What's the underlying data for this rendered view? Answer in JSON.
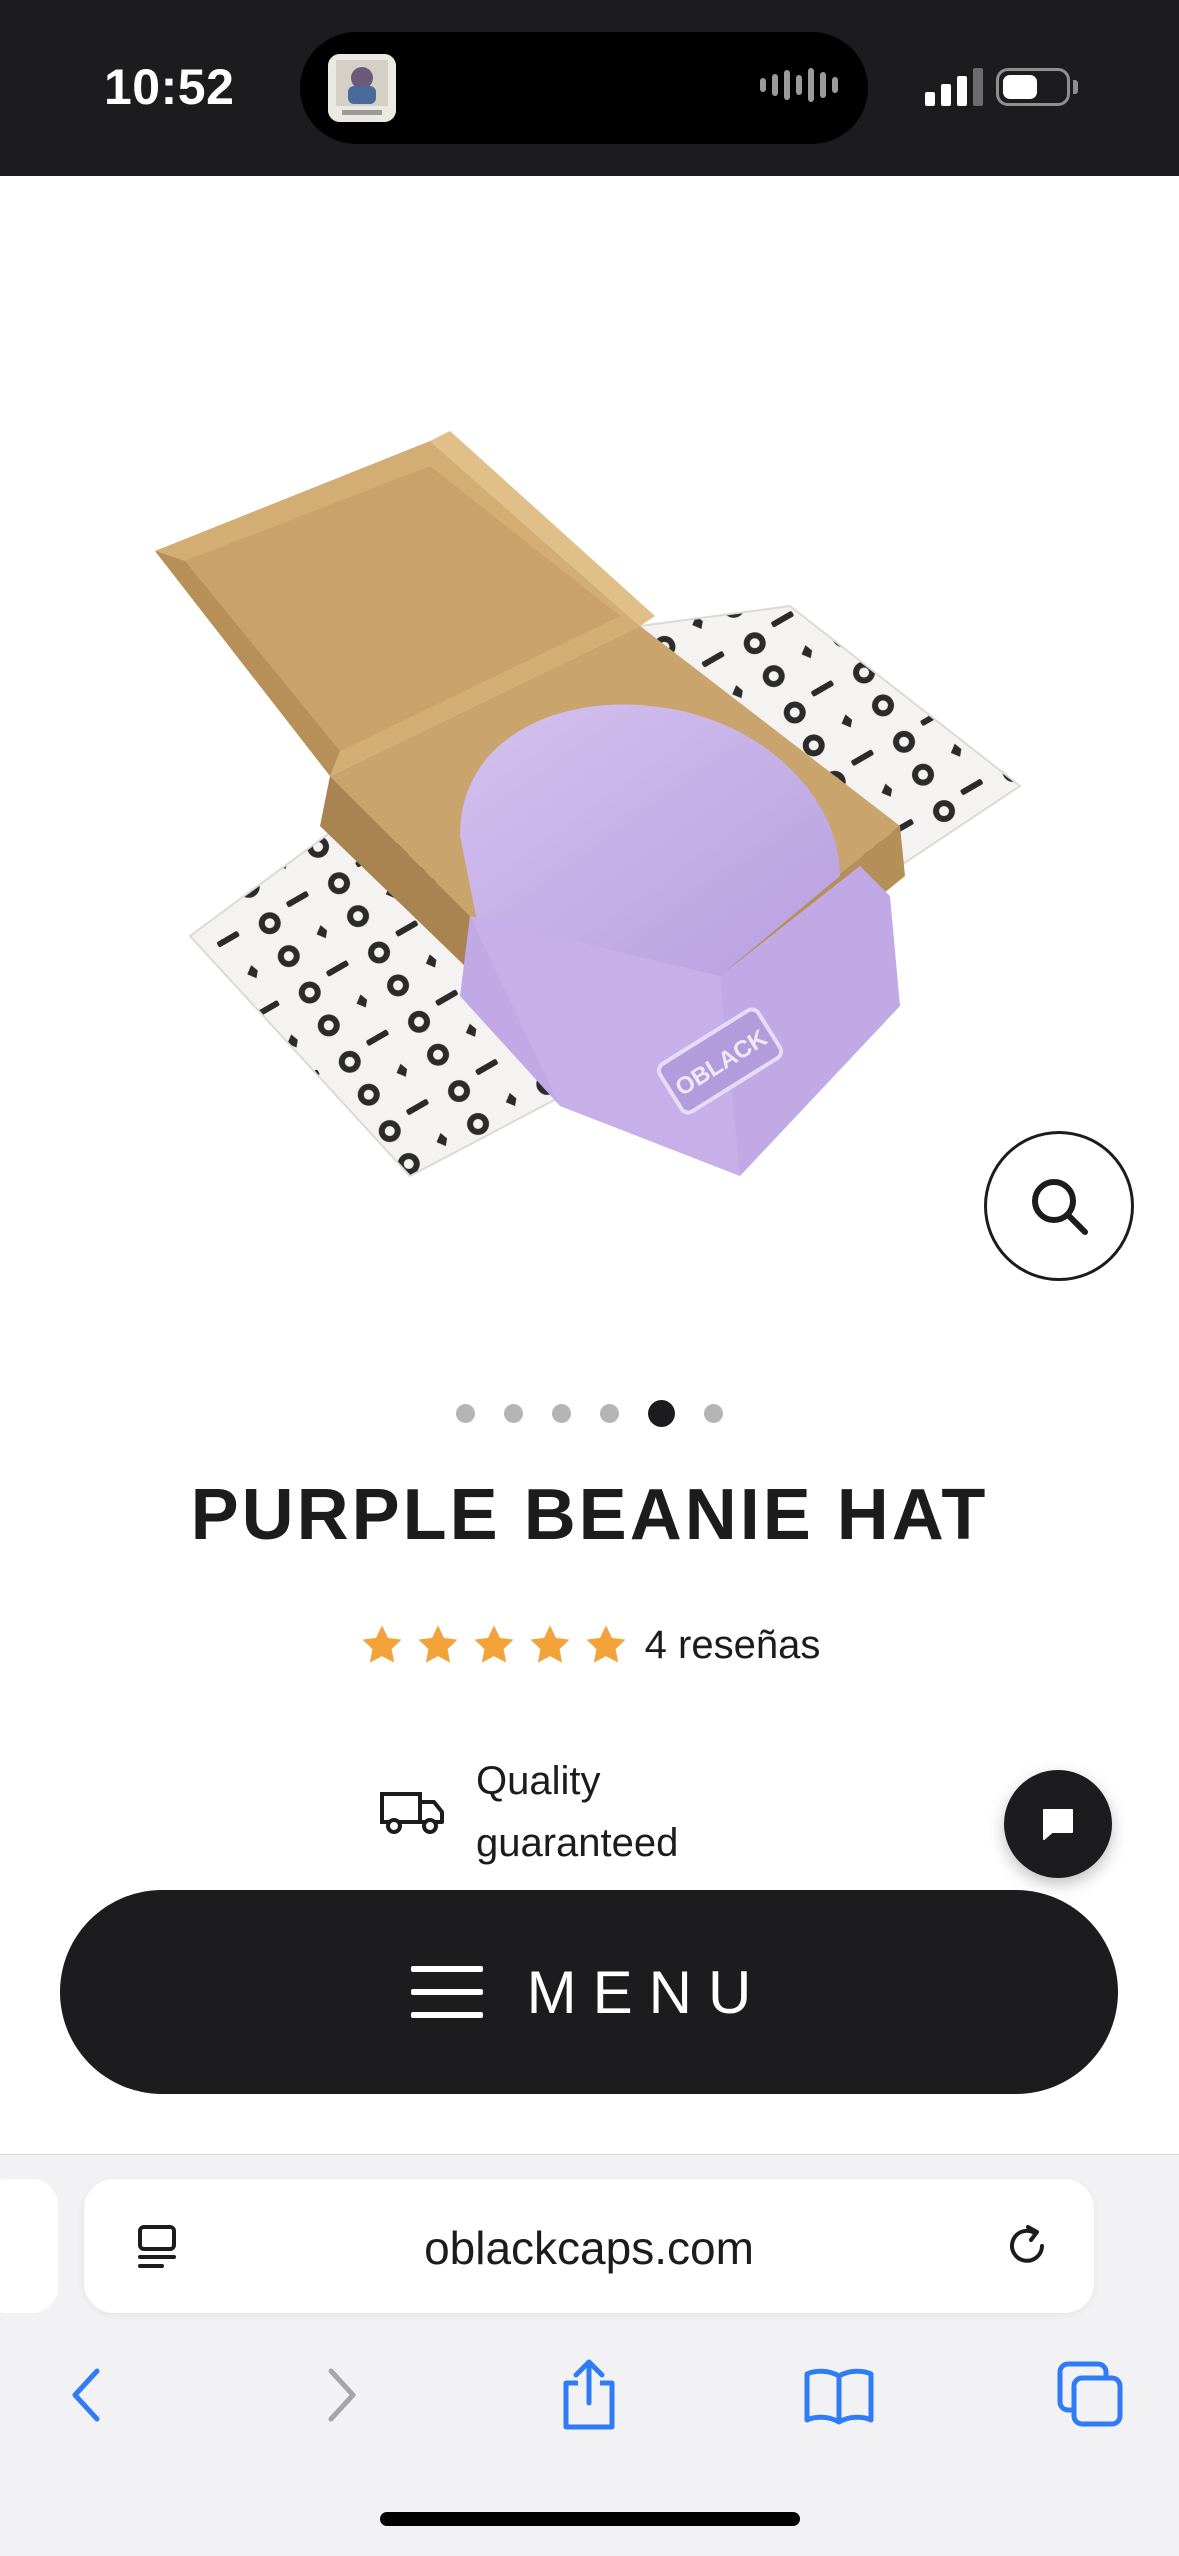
{
  "status_bar": {
    "time": "10:52",
    "signal_level": 3,
    "battery_level": 0.55,
    "icons": [
      "signal-icon",
      "battery-icon"
    ]
  },
  "colors": {
    "dark": "#1c1c1e",
    "star": "#f2a33a",
    "beanie": "#c9b3e8",
    "safari_blue": "#2f7cf6"
  },
  "gallery": {
    "total_slides": 6,
    "active_slide": 5,
    "patch_text": "OBLACK",
    "zoom_icon": "search-icon"
  },
  "product": {
    "title": "PURPLE BEANIE HAT",
    "rating": 5,
    "reviews_text": "4 reseñas",
    "feature_icon": "truck-icon",
    "feature_text": "Quality guaranteed"
  },
  "chat": {
    "icon": "chat-bubble-icon"
  },
  "menu": {
    "label": "MENU",
    "icon": "hamburger-icon"
  },
  "browser": {
    "url": "oblackcaps.com",
    "address_icon": "reader-icon",
    "reload_icon": "reload-icon",
    "toolbar_icons": [
      "back-icon",
      "forward-icon",
      "share-icon",
      "bookmarks-icon",
      "tabs-icon"
    ]
  }
}
